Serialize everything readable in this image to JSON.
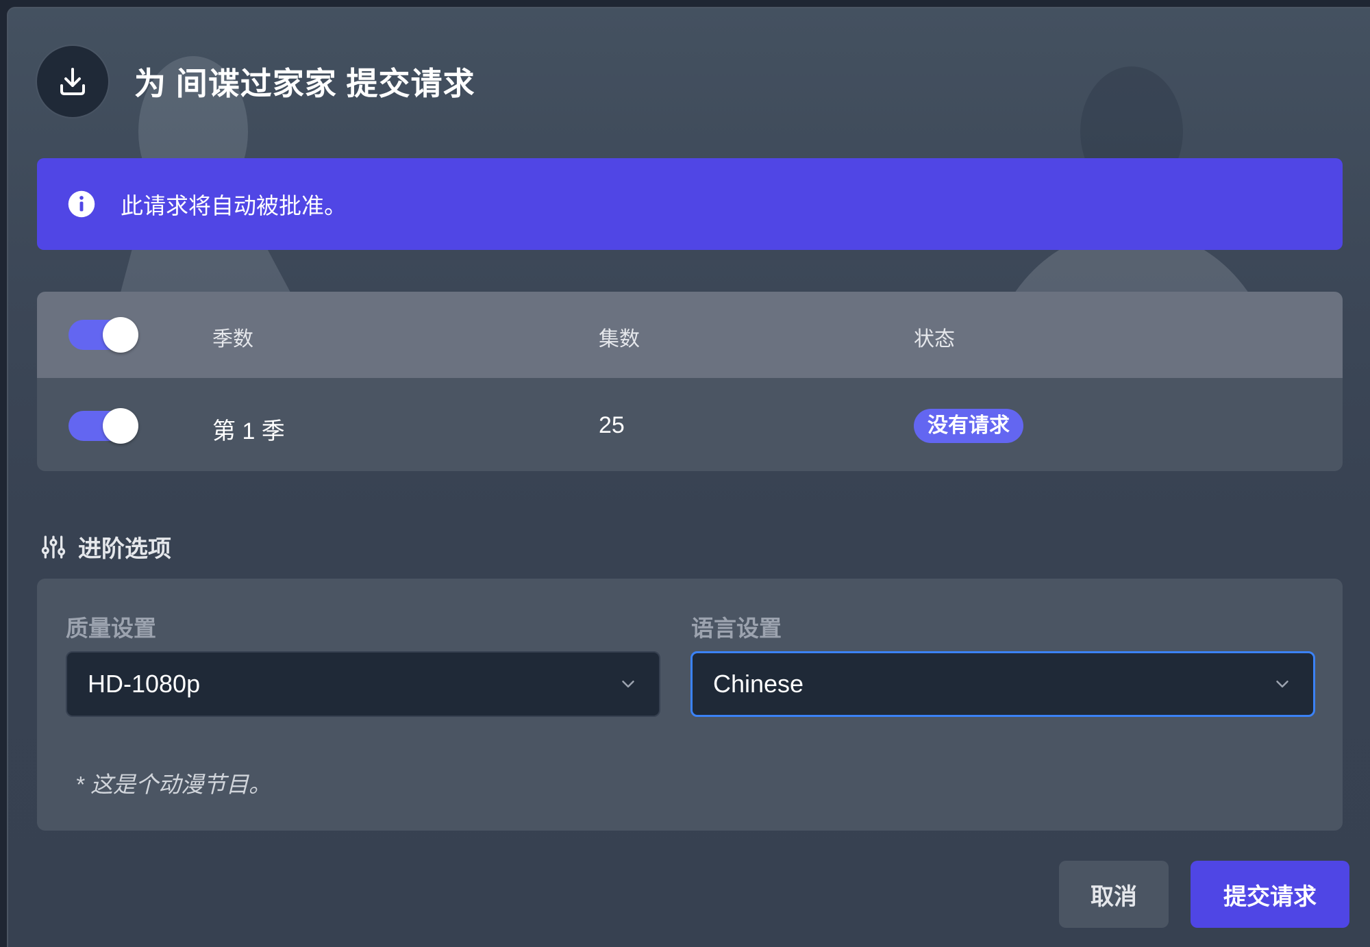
{
  "modal": {
    "title": "为 间谍过家家 提交请求",
    "header_icon": "download-icon"
  },
  "alert": {
    "icon": "info-circle-icon",
    "text": "此请求将自动被批准。",
    "color": "#5046e5"
  },
  "seasons": {
    "header": {
      "toggle_on": true,
      "columns": [
        "季数",
        "集数",
        "状态"
      ]
    },
    "rows": [
      {
        "toggle_on": true,
        "season": "第 1 季",
        "episodes": "25",
        "status": "没有请求"
      }
    ]
  },
  "advanced": {
    "icon": "sliders-icon",
    "title": "进阶选项",
    "quality": {
      "label": "质量设置",
      "value": "HD-1080p"
    },
    "language": {
      "label": "语言设置",
      "value": "Chinese"
    },
    "note": "* 这是个动漫节目。"
  },
  "buttons": {
    "cancel": "取消",
    "submit": "提交请求"
  },
  "colors": {
    "accent": "#4f46e5",
    "toggle": "#6366f1",
    "focus_ring": "#3b82f6"
  }
}
